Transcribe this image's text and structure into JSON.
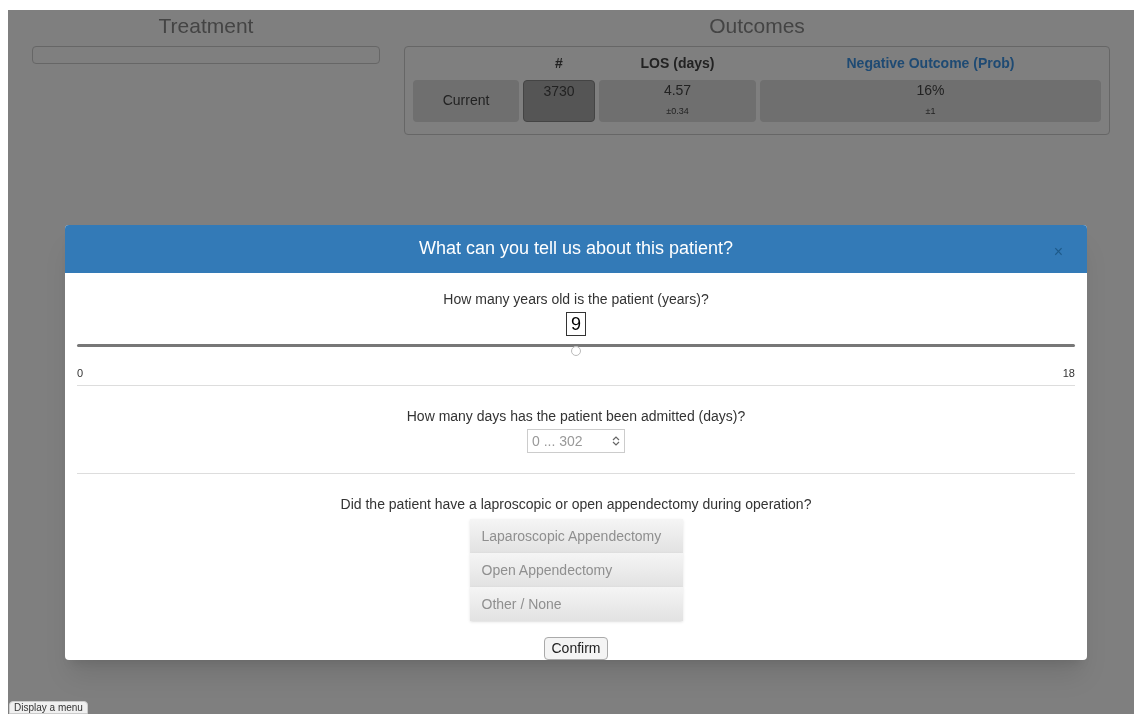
{
  "sections": [
    {
      "title": "Treatment"
    },
    {
      "title": "Outcomes"
    }
  ],
  "outcomes": {
    "columns": [
      "#",
      "LOS (days)",
      "Negative Outcome (Prob)"
    ],
    "rows": [
      {
        "label": "Current",
        "count": "3730",
        "los": "4.57",
        "los_error": "±0.34",
        "prob": "16%",
        "prob_error": "±1"
      }
    ]
  },
  "modal": {
    "title": "What can you tell us about this patient?",
    "close": "×",
    "questions": [
      {
        "kind": "slider",
        "prompt": "How many years old is the patient (years)?",
        "value": "9",
        "level": 0.5,
        "min": "0",
        "max": "18"
      },
      {
        "kind": "number",
        "prompt": "How many days has the patient been admitted (days)?",
        "placeholder": "0 ... 302"
      },
      {
        "kind": "choice",
        "prompt": "Did the patient have a laproscopic or open appendectomy during operation?",
        "options": [
          {
            "label": "Laparoscopic Appendectomy",
            "selected": false
          },
          {
            "label": "Open Appendectomy",
            "selected": false
          },
          {
            "label": "Other / None",
            "selected": false
          }
        ]
      }
    ],
    "confirm": "Confirm"
  },
  "menu_button": "Display a menu"
}
